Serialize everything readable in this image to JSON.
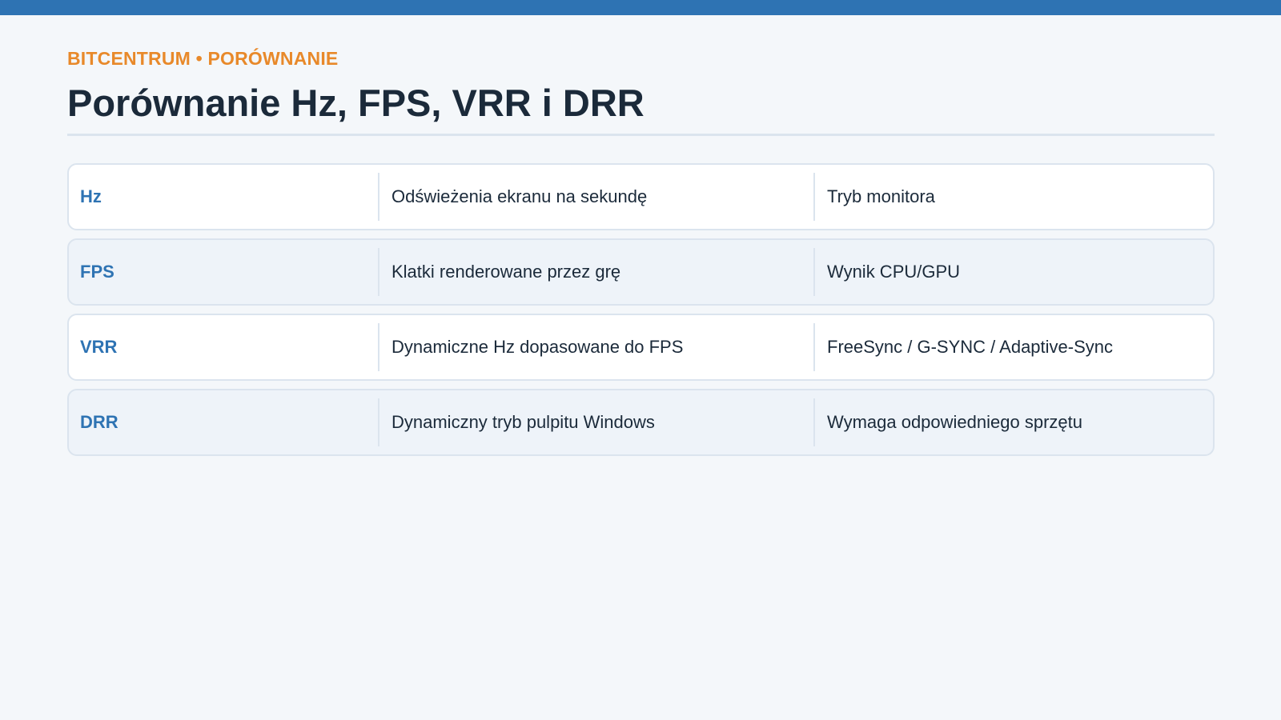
{
  "header": {
    "kicker": "BITCENTRUM • PORÓWNANIE",
    "title": "Porównanie Hz, FPS, VRR i DRR"
  },
  "colors": {
    "accent_bar": "#2e73b3",
    "kicker": "#e8892a",
    "term": "#2e73b3",
    "background": "#f4f7fa",
    "row_alt": "#eef3f9",
    "border": "#dbe4ee"
  },
  "table": {
    "rows": [
      {
        "term": "Hz",
        "description": "Odświeżenia ekranu na sekundę",
        "note": "Tryb monitora"
      },
      {
        "term": "FPS",
        "description": "Klatki renderowane przez grę",
        "note": "Wynik CPU/GPU"
      },
      {
        "term": "VRR",
        "description": "Dynamiczne Hz dopasowane do FPS",
        "note": "FreeSync / G-SYNC / Adaptive-Sync"
      },
      {
        "term": "DRR",
        "description": "Dynamiczny tryb pulpitu Windows",
        "note": "Wymaga odpowiedniego sprzętu"
      }
    ]
  }
}
